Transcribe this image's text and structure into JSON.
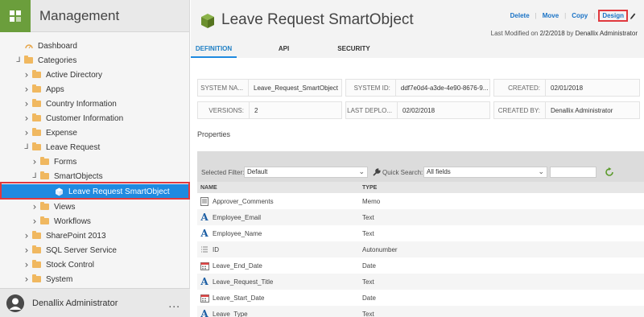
{
  "app": {
    "title": "Management"
  },
  "sidebar": {
    "items": [
      {
        "label": "Dashboard",
        "indent": 0,
        "icon": "dashboard-icon"
      },
      {
        "label": "Categories",
        "indent": 0,
        "expand": "open"
      },
      {
        "label": "Active Directory",
        "indent": 1,
        "expand": "closed"
      },
      {
        "label": "Apps",
        "indent": 1,
        "expand": "closed"
      },
      {
        "label": "Country Information",
        "indent": 1,
        "expand": "closed"
      },
      {
        "label": "Customer Information",
        "indent": 1,
        "expand": "closed"
      },
      {
        "label": "Expense",
        "indent": 1,
        "expand": "closed"
      },
      {
        "label": "Leave Request",
        "indent": 1,
        "expand": "open"
      },
      {
        "label": "Forms",
        "indent": 2,
        "expand": "closed"
      },
      {
        "label": "SmartObjects",
        "indent": 2,
        "expand": "open"
      },
      {
        "label": "Leave Request SmartObject",
        "indent": 3,
        "selected": true,
        "icon": "smartobject-icon"
      },
      {
        "label": "Views",
        "indent": 2,
        "expand": "closed"
      },
      {
        "label": "Workflows",
        "indent": 2,
        "expand": "closed"
      },
      {
        "label": "SharePoint 2013",
        "indent": 1,
        "expand": "closed"
      },
      {
        "label": "SQL Server Service",
        "indent": 1,
        "expand": "closed"
      },
      {
        "label": "Stock Control",
        "indent": 1,
        "expand": "closed"
      },
      {
        "label": "System",
        "indent": 1,
        "expand": "closed"
      }
    ],
    "footer": {
      "user": "Denallix Administrator",
      "more": "..."
    }
  },
  "header": {
    "title": "Leave Request SmartObject",
    "actions": {
      "delete": "Delete",
      "move": "Move",
      "copy": "Copy",
      "design": "Design"
    },
    "modified_prefix": "Last Modified on",
    "modified_date": "2/2/2018",
    "modified_by_prefix": "by",
    "modified_by": "Denallix Administrator"
  },
  "tabs": [
    "DEFINITION",
    "API",
    "SECURITY"
  ],
  "info": {
    "system_name_label": "SYSTEM NA...",
    "system_name": "Leave_Request_SmartObject",
    "system_id_label": "SYSTEM ID:",
    "system_id": "ddf7e0d4-a3de-4e90-8676-9...",
    "created_label": "CREATED:",
    "created": "02/01/2018",
    "versions_label": "VERSIONS:",
    "versions": "2",
    "last_deploy_label": "LAST DEPLO...",
    "last_deploy": "02/02/2018",
    "created_by_label": "CREATED BY:",
    "created_by": "Denallix Administrator"
  },
  "properties": {
    "title": "Properties",
    "selected_filter_label": "Selected Filter:",
    "selected_filter": "Default",
    "quick_search_label": "Quick Search:",
    "quick_search_field": "All fields",
    "quick_search_value": "",
    "columns": {
      "name": "NAME",
      "type": "TYPE"
    },
    "rows": [
      {
        "name": "Approver_Comments",
        "type": "Memo",
        "icon": "memo-icon"
      },
      {
        "name": "Employee_Email",
        "type": "Text",
        "icon": "text-icon"
      },
      {
        "name": "Employee_Name",
        "type": "Text",
        "icon": "text-icon"
      },
      {
        "name": "ID",
        "type": "Autonumber",
        "icon": "autonumber-icon"
      },
      {
        "name": "Leave_End_Date",
        "type": "Date",
        "icon": "date-icon"
      },
      {
        "name": "Leave_Request_Title",
        "type": "Text",
        "icon": "text-icon"
      },
      {
        "name": "Leave_Start_Date",
        "type": "Date",
        "icon": "date-icon"
      },
      {
        "name": "Leave_Type",
        "type": "Text",
        "icon": "text-icon"
      }
    ]
  },
  "colors": {
    "accent": "#1f8ae0",
    "brand": "#6b9e3c",
    "highlight": "#e0393e"
  }
}
